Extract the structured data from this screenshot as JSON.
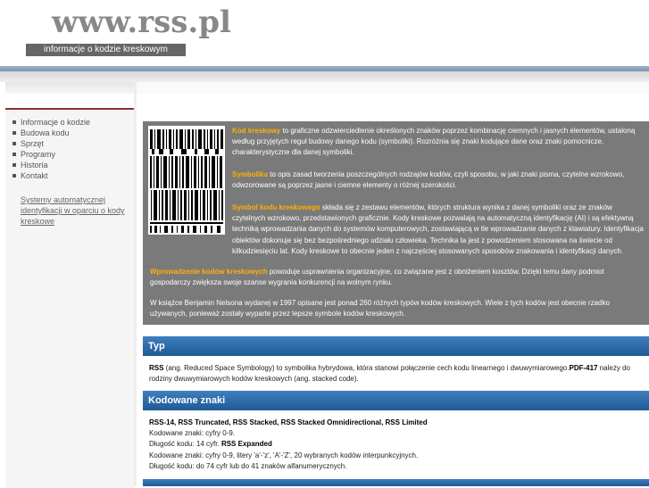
{
  "header": {
    "logo": "www.rss.pl",
    "tagline": "informacje o kodzie kreskowym"
  },
  "sidebar": {
    "items": [
      {
        "label": "Informacje o kodzie"
      },
      {
        "label": "Budowa kodu"
      },
      {
        "label": "Sprzęt"
      },
      {
        "label": "Programy"
      },
      {
        "label": "Historia"
      },
      {
        "label": "Kontakt"
      }
    ],
    "link": "Systemy automatycznej identyfikacji w oparciu o kody kreskowe"
  },
  "intro": {
    "p1_title": "Kod kreskowy",
    "p1_text": " to graficzne odzwierciedlenie określonych znaków poprzez kombinację ciemnych i jasnych elementów, ustaloną według przyjętych reguł budowy danego kodu (symboliki). Rozróżnia się znaki kodujące dane oraz znaki pomocnicze, charakterystyczne dla danej symboliki.",
    "p2_title": "Symbolika",
    "p2_text": " to opis zasad tworzenia poszczególnych rodzajów kodów, czyli sposobu, w jaki znaki pisma, czytelne wzrokowo, odwzorowane są poprzez jasne i ciemne elementy o różnej szerokości.",
    "p3_title": "Symbol kodu kreskowego",
    "p3_text": " składa się z zestawu elementów, których struktura wynika z danej symboliki oraz ze znaków czytelnych wzrokowo, przedstawionych graficznie. Kody kreskowe pozwalają na automatyczną identyfikację (AI) i są efektywną techniką wprowadzania danych do systemów komputerowych, zostawiającą w tle wprowadzanie danych z klawiatury. Identyfikacja obiektów dokonuje się bez bezpośredniego udziału człowieka. Technika ta jest z powodzeniem stosowana na świecie od kilkudziesięciu lat. Kody kreskowe to obecnie jeden z najczęściej stosowanych sposobów znakowania i identyfikacji danych.",
    "p4_title": "Wprowadzenie kodów kreskowych",
    "p4_text": " powoduje usprawnienia organizacyjne, co związane jest z obniżeniem kosztów. Dzięki temu dany podmiot gospodarczy zwiększa swoje szanse wygrania konkurencji na wolnym rynku.",
    "p5_text": "W książce Benjamin Nelsona wydanej w 1997 opisane jest ponad 260 różnych typów kodów kreskowych. Wiele z tych kodów jest obecnie rzadko używanych, ponieważ zostały wyparte przez lepsze symbole kodów kreskowych."
  },
  "typ": {
    "heading": "Typ",
    "b1": "RSS",
    "t1": " (ang. Reduced Space Symbology) to symbolika hybrydowa, która stanowi połączenie cech kodu linearnego i dwuwymiarowego.",
    "b2": "PDF-417",
    "t2": " należy do rodziny dwuwymiarowych kodów kreskowych (ang. stacked code)."
  },
  "kodowane": {
    "heading": "Kodowane znaki",
    "line1": "RSS-14, RSS Truncated, RSS Stacked, RSS Stacked Omnidirectional, RSS Limited",
    "line2": "Kodowane znaki: cyfry 0-9.",
    "line3a": "Długość kodu: 14 cyfr. ",
    "line3b": "RSS Expanded",
    "line4": "Kodowane znaki: cyfry 0-9, litery 'a'-'z', 'A'-'Z', 20 wybranych kodów interpunkcyjnych.",
    "line5": "Długość kodu: do 74 cyfr lub do 41 znaków alfanumerycznych."
  },
  "colors": {
    "accent_blue": "#1e5a95",
    "highlight": "#ffb000",
    "intro_bg": "#7a7a7a"
  }
}
